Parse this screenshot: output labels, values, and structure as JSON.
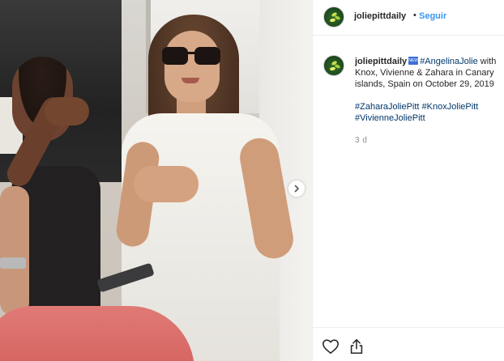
{
  "header": {
    "username": "joliepittdaily",
    "separator": "•",
    "follow_label": "Seguir"
  },
  "caption": {
    "username": "joliepittdaily",
    "badge_text": "NEW",
    "tag_main": "#AngelinaJolie",
    "text_main": " with Knox, Vivienne & Zahara in Canary islands, Spain on October 29, 2019",
    "tags": [
      "#ZaharaJoliePitt",
      "#KnoxJoliePitt",
      "#VivienneJoliePitt"
    ],
    "time": "3 d"
  },
  "icons": {
    "like": "heart-icon",
    "share": "share-icon",
    "next": "chevron-right-icon"
  },
  "colors": {
    "link": "#3897f0",
    "hashtag": "#00376b",
    "muted": "#8e8e8e",
    "text": "#262626"
  }
}
